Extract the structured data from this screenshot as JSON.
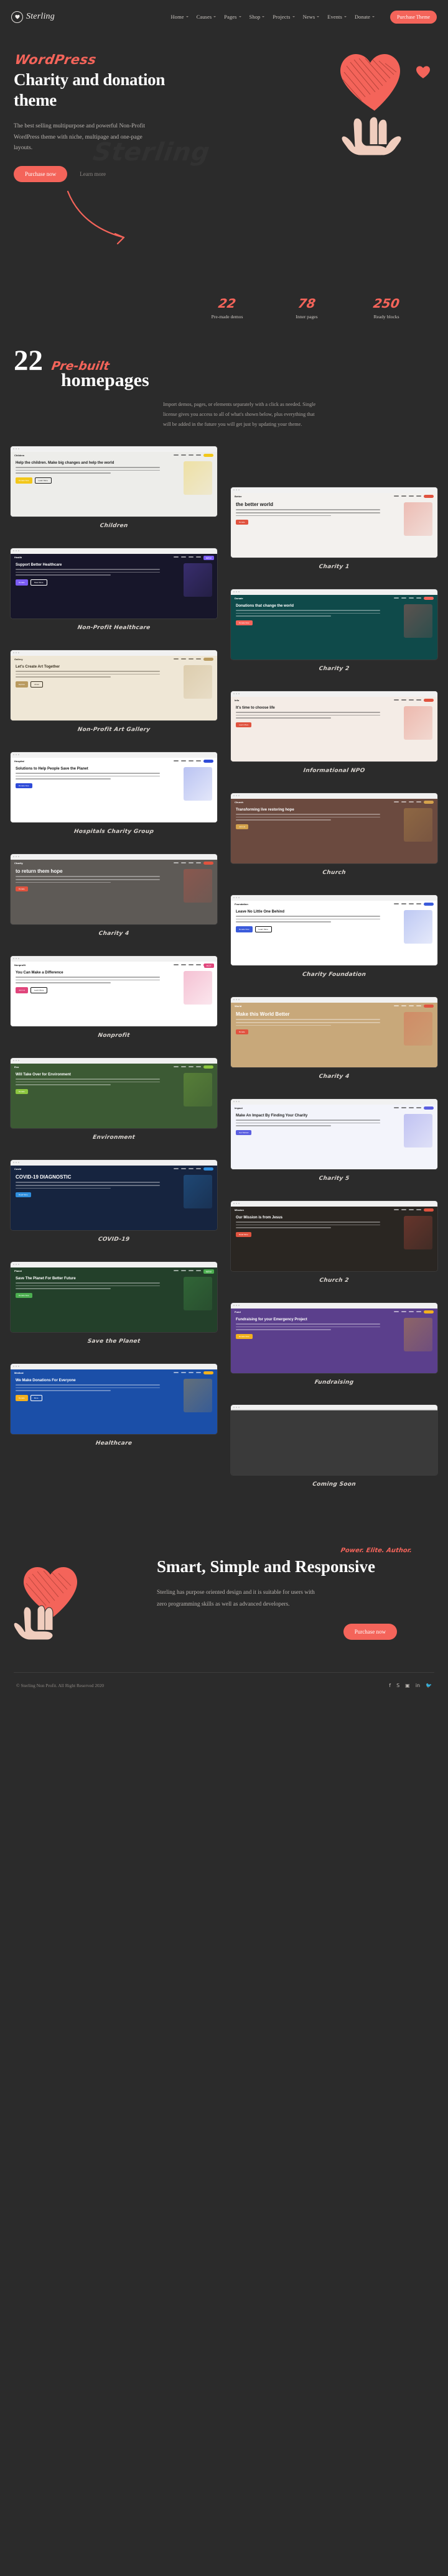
{
  "header": {
    "brand": "Sterling",
    "brand_icon": "heart-in-hand-logo-icon",
    "nav": [
      {
        "label": "Home",
        "has_dropdown": true
      },
      {
        "label": "Causes",
        "has_dropdown": true
      },
      {
        "label": "Pages",
        "has_dropdown": true
      },
      {
        "label": "Shop",
        "has_dropdown": true
      },
      {
        "label": "Projects",
        "has_dropdown": true
      },
      {
        "label": "News",
        "has_dropdown": true
      },
      {
        "label": "Events",
        "has_dropdown": true
      },
      {
        "label": "Donate",
        "has_dropdown": true
      }
    ],
    "purchase_button": "Purchase Theme"
  },
  "hero": {
    "eyebrow": "WordPress",
    "title": "Charity and donation theme",
    "description": "The best selling multipurpose and powerful Non-Profit WordPress theme with niche, multipage and one-page layouts.",
    "primary_button": "Purchase now",
    "secondary_link": "Learn more",
    "ghost_word": "Sterling"
  },
  "stats": [
    {
      "value": "22",
      "label": "Pre-made demos"
    },
    {
      "value": "78",
      "label": "Inner pages"
    },
    {
      "value": "250",
      "label": "Ready blocks"
    }
  ],
  "showcase": {
    "number": "22",
    "script": "Pre-built",
    "subtitle": "homepages",
    "description": "Import demos, pages, or elements separately with a click as needed. Single license gives you access to all of what's shown below, plus everything that will be added in the future you will get just by updating your theme."
  },
  "demos": {
    "left": [
      {
        "caption": "Children",
        "theme": "children",
        "logo": "Children",
        "headline": "Help the children. Make big changes and help the world",
        "badge": "",
        "btn1": "Donate Now",
        "btn2": "Learn More",
        "colors": {
          "bg": "#ededea",
          "accent": "#f2c71a",
          "text": "#222222",
          "nav": "#ffffff"
        }
      },
      {
        "caption": "Non-Profit Healthcare",
        "theme": "healthcare",
        "logo": "Health",
        "headline": "Support Better Healthcare",
        "badge": "NEW",
        "btn1": "Donate",
        "btn2": "Read More",
        "colors": {
          "bg": "#17162a",
          "accent": "#7b5cf5",
          "text": "#ffffff",
          "nav": "#17162a"
        }
      },
      {
        "caption": "Non-Profit Art Gallery",
        "theme": "gallery",
        "logo": "Gallery",
        "headline": "Let's Create Art Together",
        "badge": "",
        "btn1": "Explore",
        "btn2": "About",
        "colors": {
          "bg": "#efe7d6",
          "accent": "#b99a5f",
          "text": "#3a3222",
          "nav": "#efe7d6"
        }
      },
      {
        "caption": "Hospitals Charity Group",
        "theme": "hospital",
        "logo": "Hospital",
        "headline": "Solutions to Help People Save the Planet",
        "badge": "",
        "btn1": "Donate Now",
        "btn2": "",
        "colors": {
          "bg": "#ffffff",
          "accent": "#2f4bd8",
          "text": "#141414",
          "nav": "#ffffff"
        }
      },
      {
        "caption": "Charity 4",
        "theme": "photo-dark",
        "logo": "Charity",
        "headline": "to return them hope",
        "badge": "",
        "btn1": "Donate",
        "btn2": "",
        "colors": {
          "bg": "#5e5a56",
          "accent": "#e0533f",
          "text": "#ffffff",
          "nav": "transparent"
        }
      },
      {
        "caption": "Nonprofit",
        "theme": "nonprofit",
        "logo": "Nonprofit",
        "headline": "You Can Make a Difference",
        "badge": "HOT",
        "btn1": "Join Us",
        "btn2": "Learn More",
        "colors": {
          "bg": "#ffffff",
          "accent": "#e0457b",
          "text": "#151515",
          "nav": "#ffffff"
        }
      },
      {
        "caption": "Environment",
        "theme": "environment",
        "logo": "Eco",
        "headline": "Will Take Over for Environment",
        "badge": "",
        "btn1": "Donate",
        "btn2": "",
        "colors": {
          "bg": "#3c5a34",
          "accent": "#8cc63f",
          "text": "#ffffff",
          "nav": "transparent"
        }
      },
      {
        "caption": "COVID-19",
        "theme": "covid",
        "logo": "Covid",
        "headline": "COVID-19 DIAGNOSTIC",
        "badge": "",
        "btn1": "Read More",
        "btn2": "",
        "colors": {
          "bg": "#16243f",
          "accent": "#2f8ede",
          "text": "#ffffff",
          "nav": "#16243f"
        }
      },
      {
        "caption": "Save the Planet",
        "theme": "planet",
        "logo": "Planet",
        "headline": "Save The Planet For Better Future",
        "badge": "NEW",
        "btn1": "Donate Now",
        "btn2": "",
        "colors": {
          "bg": "#23402a",
          "accent": "#4caf50",
          "text": "#ffffff",
          "nav": "transparent"
        }
      },
      {
        "caption": "Healthcare",
        "theme": "healthcare2",
        "logo": "Medical",
        "headline": "We Make Donations For Everyone",
        "badge": "",
        "btn1": "Donate",
        "btn2": "More",
        "colors": {
          "bg": "#1b4fa8",
          "accent": "#f2b01e",
          "text": "#ffffff",
          "nav": "#1b4fa8"
        }
      }
    ],
    "right": [
      {
        "caption": "Charity 1",
        "theme": "betterworld",
        "logo": "Better",
        "headline": "the better world",
        "badge": "",
        "btn1": "Donate",
        "btn2": "",
        "colors": {
          "bg": "#f3f1ee",
          "accent": "#e0533f",
          "text": "#1d1d1d",
          "nav": "#f3f1ee"
        }
      },
      {
        "caption": "Charity 2",
        "theme": "donations",
        "logo": "Donate",
        "headline": "Donations that change the world",
        "badge": "",
        "btn1": "Donate Now",
        "btn2": "",
        "colors": {
          "bg": "#0f4a4a",
          "accent": "#f4645a",
          "text": "#ffffff",
          "nav": "#0f4a4a"
        }
      },
      {
        "caption": "Informational NPO",
        "theme": "informational",
        "logo": "Info",
        "headline": "It's time to choose life",
        "badge": "",
        "btn1": "Learn More",
        "btn2": "",
        "colors": {
          "bg": "#f4ece6",
          "accent": "#e0533f",
          "text": "#1d1d1d",
          "nav": "#f4ece6"
        }
      },
      {
        "caption": "Church",
        "theme": "church",
        "logo": "Church",
        "headline": "Transforming live restoring hope",
        "badge": "",
        "btn1": "Join Us",
        "btn2": "",
        "colors": {
          "bg": "#6b4a3f",
          "accent": "#d4a24c",
          "text": "#ffffff",
          "nav": "transparent"
        }
      },
      {
        "caption": "Charity Foundation",
        "theme": "foundation",
        "logo": "Foundation",
        "headline": "Leave No Little One Behind",
        "badge": "",
        "btn1": "Donate Now",
        "btn2": "Learn More",
        "colors": {
          "bg": "#ffffff",
          "accent": "#3b5bdb",
          "text": "#141414",
          "nav": "#ffffff"
        }
      },
      {
        "caption": "Charity 4",
        "theme": "worldbetter",
        "logo": "World",
        "headline": "Make this World Better",
        "badge": "",
        "btn1": "Donate",
        "btn2": "",
        "colors": {
          "bg": "#c8a87a",
          "accent": "#e0533f",
          "text": "#ffffff",
          "nav": "transparent"
        }
      },
      {
        "caption": "Charity 5",
        "theme": "impact",
        "logo": "Impact",
        "headline": "Make An Impact By Finding Your Charity",
        "badge": "",
        "btn1": "Get Started",
        "btn2": "",
        "colors": {
          "bg": "#f3f4fb",
          "accent": "#5b5fe0",
          "text": "#1d1d1d",
          "nav": "#f3f4fb"
        }
      },
      {
        "caption": "Church 2",
        "theme": "church2",
        "logo": "Mission",
        "headline": "Our Mission is from Jesus",
        "badge": "",
        "btn1": "Read More",
        "btn2": "",
        "colors": {
          "bg": "#2a2622",
          "accent": "#e0533f",
          "text": "#ffffff",
          "nav": "transparent"
        }
      },
      {
        "caption": "Fundraising",
        "theme": "fundraising",
        "logo": "Fund",
        "headline": "Fundraising for your Emergency Project",
        "badge": "",
        "btn1": "Donate Now",
        "btn2": "",
        "colors": {
          "bg": "#5b3f8c",
          "accent": "#f2b01e",
          "text": "#ffffff",
          "nav": "transparent"
        }
      },
      {
        "caption": "Coming Soon",
        "theme": "coming-soon",
        "logo": "",
        "headline": "",
        "badge": "",
        "btn1": "",
        "btn2": "",
        "colors": {
          "bg": "#3a3a3a",
          "accent": "#5a5a5a",
          "text": "#8a8a8a",
          "nav": "transparent"
        }
      }
    ]
  },
  "closing": {
    "script": "Power. Elite. Author.",
    "title": "Smart, Simple and Responsive",
    "description": "Sterling has purpose oriented design and it is suitable for users with zero programming skills as well as advanced developers.",
    "button": "Purchase now",
    "art_icon": "heart-in-hand-icon"
  },
  "footer": {
    "copyright": "© Sterling Non Profit. All Right Reserved 2020",
    "socials": [
      {
        "name": "facebook-icon",
        "glyph": "f"
      },
      {
        "name": "skype-icon",
        "glyph": "S"
      },
      {
        "name": "instagram-icon",
        "glyph": "▣"
      },
      {
        "name": "linkedin-icon",
        "glyph": "in"
      },
      {
        "name": "twitter-icon",
        "glyph": "🐦"
      }
    ]
  },
  "colors": {
    "page_bg": "#2b2b2b",
    "accent": "#f4645a",
    "heading": "#ffffff",
    "muted": "#b9b4b0"
  }
}
